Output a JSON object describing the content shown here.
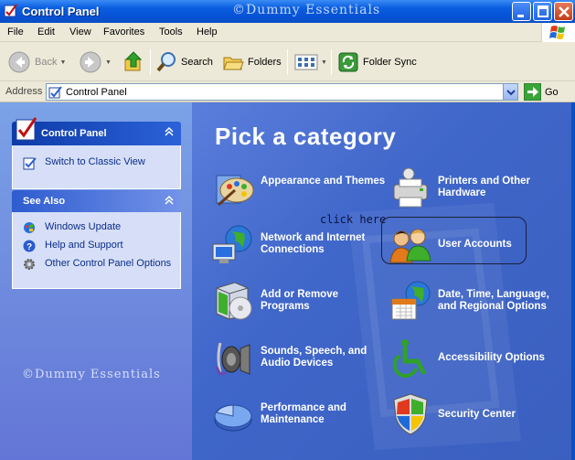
{
  "window": {
    "title": "Control Panel",
    "watermark": "©Dummy Essentials"
  },
  "menu": [
    "File",
    "Edit",
    "View",
    "Favorites",
    "Tools",
    "Help"
  ],
  "toolbar": {
    "back": "Back",
    "search": "Search",
    "folders": "Folders",
    "folder_sync": "Folder Sync"
  },
  "address": {
    "label": "Address",
    "value": "Control Panel",
    "go": "Go"
  },
  "sidebar": {
    "control_panel": {
      "title": "Control Panel",
      "links": [
        "Switch to Classic View"
      ]
    },
    "see_also": {
      "title": "See Also",
      "links": [
        "Windows Update",
        "Help and Support",
        "Other Control Panel Options"
      ]
    },
    "watermark": "©Dummy Essentials"
  },
  "main": {
    "heading": "Pick a category",
    "annotation": "click here",
    "categories": [
      "Appearance and Themes",
      "Printers and Other Hardware",
      "Network and Internet Connections",
      "User Accounts",
      "Add or Remove Programs",
      "Date, Time, Language, and Regional Options",
      "Sounds, Speech, and Audio Devices",
      "Accessibility Options",
      "Performance and Maintenance",
      "Security Center"
    ]
  },
  "colors": {
    "titlebar": "#0a5ee0",
    "chrome": "#ece9d8",
    "main_bg": "#3f66c9",
    "sidebar_bg": "#7ba2e7"
  }
}
